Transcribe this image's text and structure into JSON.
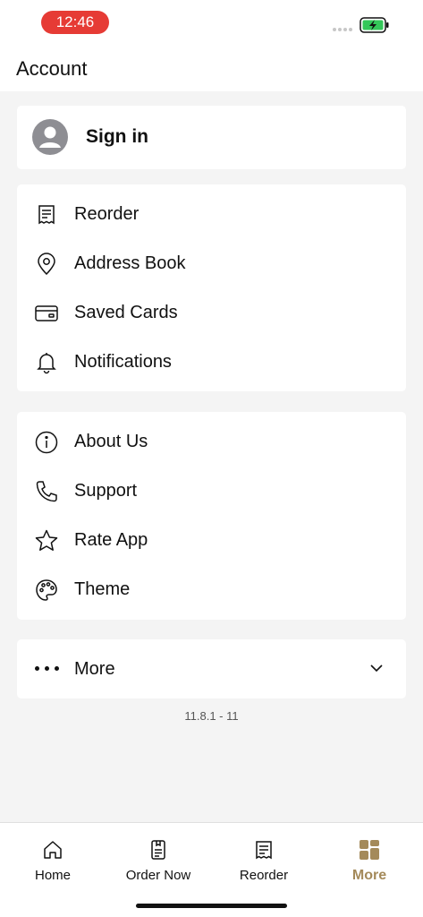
{
  "status_bar": {
    "time": "12:46"
  },
  "header": {
    "title": "Account"
  },
  "signin": {
    "label": "Sign in"
  },
  "group_one": [
    {
      "label": "Reorder",
      "icon": "receipt-icon"
    },
    {
      "label": "Address Book",
      "icon": "location-pin-icon"
    },
    {
      "label": "Saved Cards",
      "icon": "credit-card-icon"
    },
    {
      "label": "Notifications",
      "icon": "bell-icon"
    }
  ],
  "group_two": [
    {
      "label": "About Us",
      "icon": "info-icon"
    },
    {
      "label": "Support",
      "icon": "phone-icon"
    },
    {
      "label": "Rate App",
      "icon": "star-icon"
    },
    {
      "label": "Theme",
      "icon": "palette-icon"
    }
  ],
  "more": {
    "label": "More"
  },
  "version": "11.8.1 - 11",
  "tabs": [
    {
      "label": "Home",
      "icon": "home-icon"
    },
    {
      "label": "Order Now",
      "icon": "order-icon"
    },
    {
      "label": "Reorder",
      "icon": "receipt-icon"
    },
    {
      "label": "More",
      "icon": "grid-icon",
      "active": true
    }
  ],
  "colors": {
    "accent": "#a48a5a",
    "time_pill": "#e63b35",
    "battery": "#34c759",
    "background": "#f4f4f4"
  }
}
